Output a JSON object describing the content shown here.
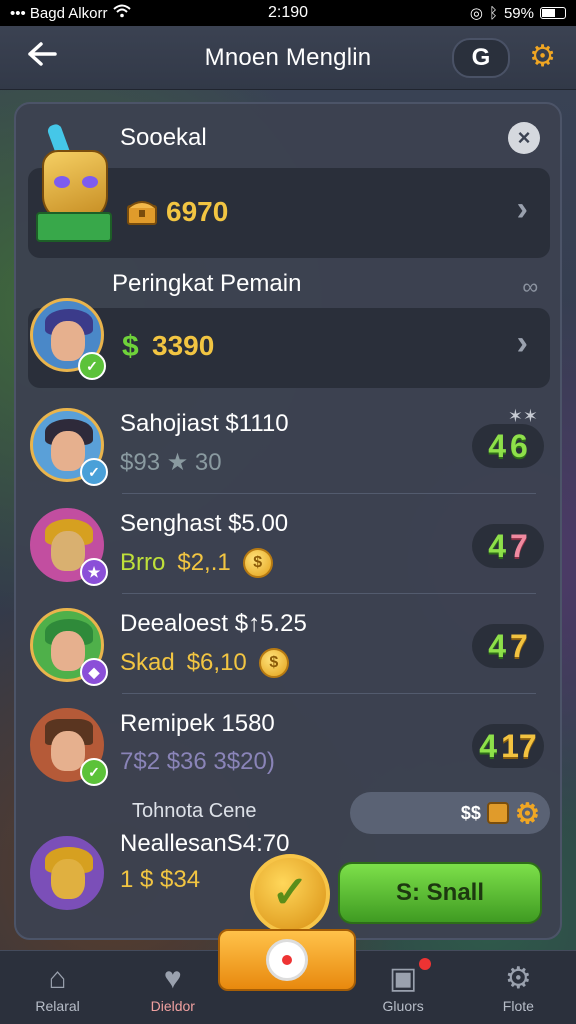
{
  "status_bar": {
    "carrier": "••• Bagd Alkorr",
    "time": "2:190",
    "battery": "59%"
  },
  "header": {
    "title": "Mnoen Menglin",
    "g_button_label": "G"
  },
  "section_top": {
    "title": "Sooekal",
    "value": "6970"
  },
  "section_rank": {
    "title": "Peringkat Pemain",
    "value": "3390"
  },
  "players": [
    {
      "name": "Sahojiast $1110",
      "sub1": "$93 ★ 30",
      "sub2": "",
      "score_a": "4",
      "score_b": "6"
    },
    {
      "name": "Senghast $5.00",
      "sub1": "Brro",
      "sub2": "$2,.1",
      "score_a": "4",
      "score_b": "7"
    },
    {
      "name": "Deealoest $↑5.25",
      "sub1": "Skad",
      "sub2": "$6,10",
      "score_a": "4",
      "score_b": "7"
    },
    {
      "name": "Remipek 1580",
      "sub1": "7$2 $36 3$20)",
      "sub2": "",
      "score_a": "4",
      "score_b": "17"
    },
    {
      "name": "NeallesanS4:70",
      "sub1": "1 $ $34",
      "sub2": "",
      "score_a": "",
      "score_b": ""
    }
  ],
  "toggle_row": {
    "label": "Tohnota Cene",
    "value": "$$"
  },
  "send_button": "S: Snall",
  "nav": {
    "items": [
      "Relaral",
      "Dieldor",
      "Gluors",
      "Flote"
    ]
  },
  "colors": {
    "accent_gold": "#f2c542",
    "accent_green": "#7de04a",
    "panel": "#3c4250"
  }
}
